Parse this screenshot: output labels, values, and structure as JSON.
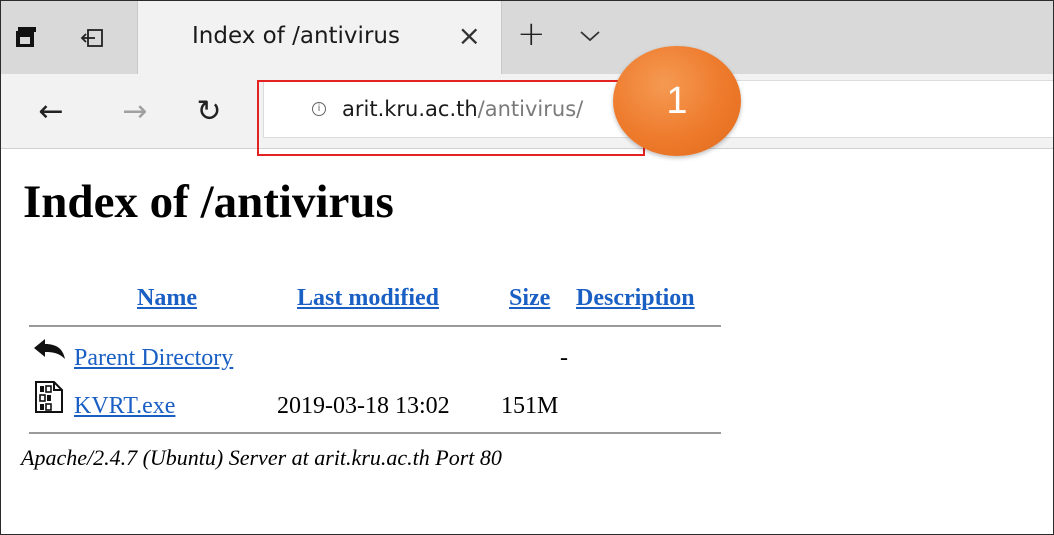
{
  "tab": {
    "title": "Index of /antivirus",
    "close_glyph": "×",
    "new_tab_glyph": "+"
  },
  "nav": {
    "back_glyph": "←",
    "forward_glyph": "→",
    "refresh_glyph": "↻"
  },
  "address": {
    "host": "arit.kru.ac.th",
    "path": "/antivirus/"
  },
  "annotation": {
    "step_number": "1",
    "highlight_color": "#e52222",
    "badge_color": "#ee7a2c"
  },
  "page": {
    "heading": "Index of /antivirus",
    "columns": {
      "name": "Name",
      "last_modified": "Last modified",
      "size": "Size",
      "description": "Description"
    },
    "rows": [
      {
        "icon": "back-arrow-icon",
        "name": "Parent Directory",
        "last_modified": "",
        "size": "-"
      },
      {
        "icon": "binary-file-icon",
        "name": "KVRT.exe",
        "last_modified": "2019-03-18 13:02",
        "size": "151M"
      }
    ],
    "footer": "Apache/2.4.7 (Ubuntu) Server at arit.kru.ac.th Port 80",
    "link_color": "#1a5fc4"
  }
}
